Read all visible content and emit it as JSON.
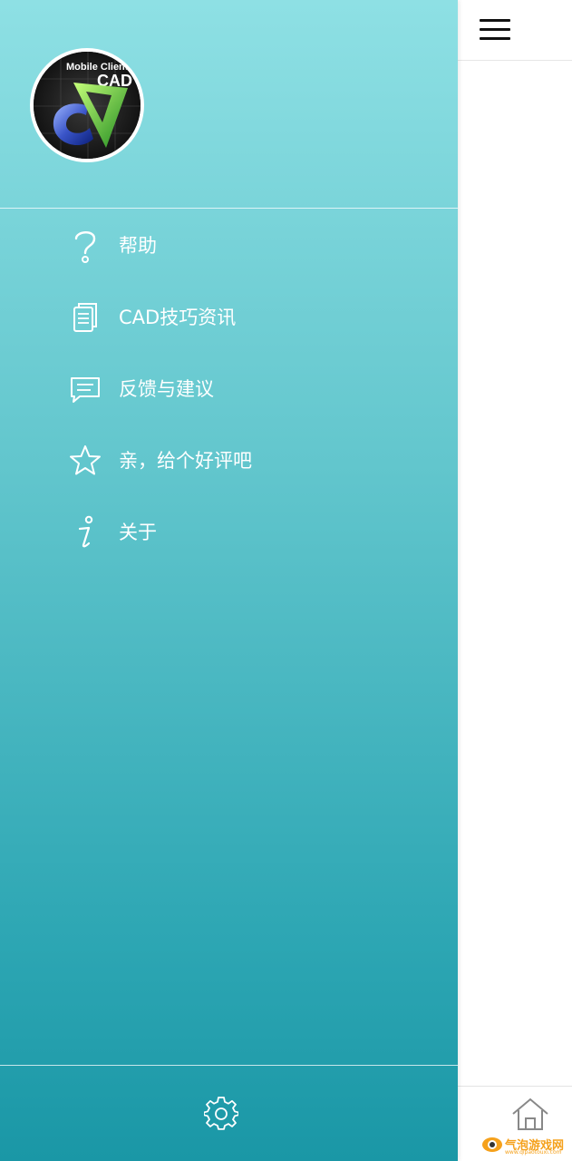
{
  "drawer": {
    "avatar": {
      "logo_text_top": "Mobile Client",
      "logo_text_main": "CAD"
    },
    "menu": [
      {
        "id": "help",
        "icon": "question-mark-icon",
        "label": "帮助"
      },
      {
        "id": "cad-tips",
        "icon": "document-icon",
        "label": "CAD技巧资讯"
      },
      {
        "id": "feedback",
        "icon": "chat-bubble-icon",
        "label": "反馈与建议"
      },
      {
        "id": "rate",
        "icon": "star-icon",
        "label": "亲，给个好评吧"
      },
      {
        "id": "about",
        "icon": "info-icon",
        "label": "关于"
      }
    ],
    "footer": {
      "settings_icon": "gear-icon"
    }
  },
  "content": {
    "topbar": {
      "menu_icon": "hamburger-menu-icon"
    },
    "bottombar": {
      "home_icon": "home-icon"
    }
  },
  "watermark": {
    "text": "气泡游戏网",
    "sub": "www.qipaotouxi.com"
  },
  "colors": {
    "drawer_top": "#8ee0e4",
    "drawer_bottom": "#1a97a6",
    "watermark": "#f5a11c"
  }
}
